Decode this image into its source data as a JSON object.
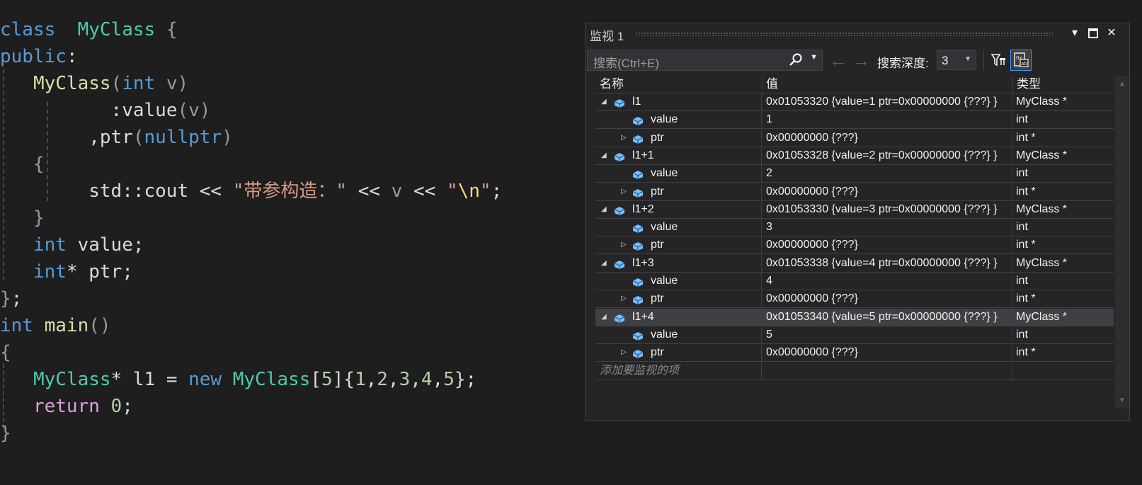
{
  "editor": {
    "lines": [
      {
        "tokens": [
          [
            "kw",
            "class"
          ],
          [
            "",
            "  "
          ],
          [
            "ty",
            "MyClass"
          ],
          [
            "pa",
            " {"
          ]
        ]
      },
      {
        "tokens": [
          [
            "kw",
            "public"
          ],
          [
            "",
            ":"
          ]
        ]
      },
      {
        "tokens": [
          [
            "",
            "   "
          ],
          [
            "fn",
            "MyClass"
          ],
          [
            "pa",
            "("
          ],
          [
            "kw",
            "int"
          ],
          [
            "pa",
            " v"
          ],
          [
            "pa",
            ")"
          ]
        ]
      },
      {
        "tokens": [
          [
            "",
            "      "
          ],
          [
            "",
            "    :"
          ],
          [
            "me",
            "value"
          ],
          [
            "pa",
            "("
          ],
          [
            "pa",
            "v"
          ],
          [
            "pa",
            ")"
          ]
        ]
      },
      {
        "tokens": [
          [
            "",
            "    "
          ],
          [
            "",
            "    ,"
          ],
          [
            "me",
            "ptr"
          ],
          [
            "pa",
            "("
          ],
          [
            "kw",
            "nullptr"
          ],
          [
            "pa",
            ")"
          ]
        ]
      },
      {
        "tokens": [
          [
            "",
            "   "
          ],
          [
            "pa",
            "{"
          ]
        ]
      },
      {
        "tokens": [
          [
            "",
            "        "
          ],
          [
            "me",
            "std::cout << "
          ],
          [
            "st",
            "\"带参构造：\""
          ],
          [
            "me",
            " << "
          ],
          [
            "pa",
            "v"
          ],
          [
            "me",
            " << "
          ],
          [
            "st",
            "\""
          ],
          [
            "esc",
            "\\n"
          ],
          [
            "st",
            "\""
          ],
          [
            "me",
            ";"
          ]
        ]
      },
      {
        "tokens": [
          [
            "",
            "   "
          ],
          [
            "pa",
            "}"
          ]
        ]
      },
      {
        "tokens": [
          [
            "",
            "   "
          ],
          [
            "kw",
            "int"
          ],
          [
            "me",
            " value;"
          ]
        ]
      },
      {
        "tokens": [
          [
            "",
            "   "
          ],
          [
            "kw",
            "int"
          ],
          [
            "me",
            "* ptr;"
          ]
        ]
      },
      {
        "tokens": [
          [
            "pa",
            "}"
          ],
          [
            "me",
            ";"
          ]
        ]
      },
      {
        "tokens": [
          [
            "kw",
            "int"
          ],
          [
            "me",
            " "
          ],
          [
            "fn",
            "main"
          ],
          [
            "pa",
            "()"
          ]
        ]
      },
      {
        "tokens": [
          [
            "pa",
            "{"
          ]
        ]
      },
      {
        "tokens": [
          [
            "",
            "   "
          ],
          [
            "ty",
            "MyClass"
          ],
          [
            "me",
            "* l1 = "
          ],
          [
            "kw",
            "new"
          ],
          [
            "me",
            " "
          ],
          [
            "ty",
            "MyClass"
          ],
          [
            "me",
            "["
          ],
          [
            "nu",
            "5"
          ],
          [
            "me",
            "]{"
          ],
          [
            "nu",
            "1"
          ],
          [
            "me",
            ","
          ],
          [
            "nu",
            "2"
          ],
          [
            "me",
            ","
          ],
          [
            "nu",
            "3"
          ],
          [
            "me",
            ","
          ],
          [
            "nu",
            "4"
          ],
          [
            "me",
            ","
          ],
          [
            "nu",
            "5"
          ],
          [
            "me",
            "};"
          ]
        ]
      },
      {
        "tokens": [
          [
            "",
            "   "
          ],
          [
            "kw2",
            "return"
          ],
          [
            "me",
            " "
          ],
          [
            "nu",
            "0"
          ],
          [
            "me",
            ";"
          ]
        ]
      },
      {
        "tokens": [
          [
            "pa",
            "}"
          ]
        ]
      }
    ]
  },
  "watch": {
    "title": "监视 1",
    "search_placeholder": "搜索(Ctrl+E)",
    "depth_label": "搜索深度:",
    "depth_value": "3",
    "columns": {
      "name": "名称",
      "value": "值",
      "type": "类型"
    },
    "rows": [
      {
        "level": 0,
        "expander": "open",
        "name": "l1",
        "value": "0x01053320 {value=1 ptr=0x00000000 {???} }",
        "type": "MyClass *"
      },
      {
        "level": 1,
        "expander": "none",
        "name": "value",
        "value": "1",
        "type": "int"
      },
      {
        "level": 1,
        "expander": "closed",
        "name": "ptr",
        "value": "0x00000000 {???}",
        "type": "int *"
      },
      {
        "level": 0,
        "expander": "open",
        "name": "l1+1",
        "value": "0x01053328 {value=2 ptr=0x00000000 {???} }",
        "type": "MyClass *"
      },
      {
        "level": 1,
        "expander": "none",
        "name": "value",
        "value": "2",
        "type": "int"
      },
      {
        "level": 1,
        "expander": "closed",
        "name": "ptr",
        "value": "0x00000000 {???}",
        "type": "int *"
      },
      {
        "level": 0,
        "expander": "open",
        "name": "l1+2",
        "value": "0x01053330 {value=3 ptr=0x00000000 {???} }",
        "type": "MyClass *"
      },
      {
        "level": 1,
        "expander": "none",
        "name": "value",
        "value": "3",
        "type": "int"
      },
      {
        "level": 1,
        "expander": "closed",
        "name": "ptr",
        "value": "0x00000000 {???}",
        "type": "int *"
      },
      {
        "level": 0,
        "expander": "open",
        "name": "l1+3",
        "value": "0x01053338 {value=4 ptr=0x00000000 {???} }",
        "type": "MyClass *"
      },
      {
        "level": 1,
        "expander": "none",
        "name": "value",
        "value": "4",
        "type": "int"
      },
      {
        "level": 1,
        "expander": "closed",
        "name": "ptr",
        "value": "0x00000000 {???}",
        "type": "int *"
      },
      {
        "level": 0,
        "expander": "open",
        "name": "l1+4",
        "value": "0x01053340 {value=5 ptr=0x00000000 {???} }",
        "type": "MyClass *",
        "selected": true
      },
      {
        "level": 1,
        "expander": "none",
        "name": "value",
        "value": "5",
        "type": "int"
      },
      {
        "level": 1,
        "expander": "closed",
        "name": "ptr",
        "value": "0x00000000 {???}",
        "type": "int *"
      }
    ],
    "add_item_placeholder": "添加要监视的项",
    "icons": {
      "search": "search-icon",
      "back": "arrow-left-icon",
      "forward": "arrow-right-icon",
      "pin": "filter-pin-icon",
      "hex": "hex-view-icon",
      "object": "object-cube-icon"
    }
  }
}
